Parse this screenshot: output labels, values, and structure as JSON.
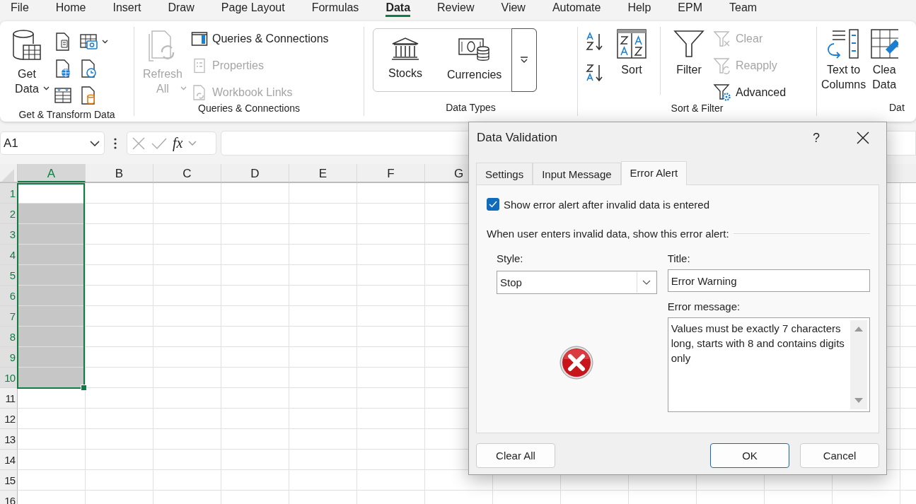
{
  "menu_tabs": [
    {
      "label": "File",
      "selected": false
    },
    {
      "label": "Home",
      "selected": false
    },
    {
      "label": "Insert",
      "selected": false
    },
    {
      "label": "Draw",
      "selected": false
    },
    {
      "label": "Page Layout",
      "selected": false
    },
    {
      "label": "Formulas",
      "selected": false
    },
    {
      "label": "Data",
      "selected": true
    },
    {
      "label": "Review",
      "selected": false
    },
    {
      "label": "View",
      "selected": false
    },
    {
      "label": "Automate",
      "selected": false
    },
    {
      "label": "Help",
      "selected": false
    },
    {
      "label": "EPM",
      "selected": false
    },
    {
      "label": "Team",
      "selected": false
    }
  ],
  "ribbon": {
    "get_transform": {
      "get_data": [
        "Get",
        "Data"
      ],
      "label": "Get & Transform Data"
    },
    "queries": {
      "refresh_all": {
        "lines": [
          "Refresh",
          "All"
        ],
        "disabled": true
      },
      "items": [
        {
          "kind": "queries",
          "label": "Queries & Connections",
          "disabled": false
        },
        {
          "kind": "properties",
          "label": "Properties",
          "disabled": true
        },
        {
          "kind": "links",
          "label": "Workbook Links",
          "disabled": true
        }
      ],
      "label": "Queries & Connections"
    },
    "data_types": {
      "items": [
        {
          "kind": "stocks",
          "label": "Stocks"
        },
        {
          "kind": "currencies",
          "label": "Currencies"
        }
      ],
      "label": "Data Types"
    },
    "sort_filter": {
      "sort": "Sort",
      "filter": "Filter",
      "items": [
        {
          "kind": "clear",
          "label": "Clear",
          "disabled": true
        },
        {
          "kind": "reapply",
          "label": "Reapply",
          "disabled": true
        },
        {
          "kind": "advanced",
          "label": "Advanced",
          "disabled": false
        }
      ],
      "label": "Sort & Filter"
    },
    "data_tools": {
      "buttons": [
        {
          "kind": "text_to_columns",
          "lines": [
            "Text to",
            "Columns"
          ]
        },
        {
          "kind": "clear_data",
          "lines": [
            "Clea",
            "Data"
          ]
        }
      ],
      "label": "Dat"
    }
  },
  "formula_bar": {
    "name_box": "A1",
    "function_label": "fx"
  },
  "grid": {
    "columns": [
      {
        "label": "A",
        "selected": true
      },
      {
        "label": "B",
        "selected": false
      },
      {
        "label": "C",
        "selected": false
      },
      {
        "label": "D",
        "selected": false
      },
      {
        "label": "E",
        "selected": false
      },
      {
        "label": "F",
        "selected": false
      },
      {
        "label": "G",
        "selected": false
      }
    ],
    "rows": [
      {
        "label": "1",
        "selected": true
      },
      {
        "label": "2",
        "selected": true
      },
      {
        "label": "3",
        "selected": true
      },
      {
        "label": "4",
        "selected": true
      },
      {
        "label": "5",
        "selected": true
      },
      {
        "label": "6",
        "selected": true
      },
      {
        "label": "7",
        "selected": true
      },
      {
        "label": "8",
        "selected": true
      },
      {
        "label": "9",
        "selected": true
      },
      {
        "label": "10",
        "selected": true
      },
      {
        "label": "11",
        "selected": false
      },
      {
        "label": "12",
        "selected": false
      },
      {
        "label": "13",
        "selected": false
      },
      {
        "label": "14",
        "selected": false
      },
      {
        "label": "15",
        "selected": false
      },
      {
        "label": "16",
        "selected": false
      }
    ]
  },
  "dialog": {
    "title": "Data Validation",
    "help": "?",
    "tabs": [
      {
        "label": "Settings",
        "selected": false
      },
      {
        "label": "Input Message",
        "selected": false
      },
      {
        "label": "Error Alert",
        "selected": true
      }
    ],
    "show_alert": {
      "label": "Show error alert after invalid data is entered",
      "checked": true
    },
    "section": "When user enters invalid data, show this error alert:",
    "style": {
      "label": "Style:",
      "value": "Stop"
    },
    "title_field": {
      "label": "Title:",
      "value": "Error Warning"
    },
    "message": {
      "label": "Error message:",
      "value": "Values must be exactly 7 characters long, starts with 8 and contains digits only"
    },
    "buttons": [
      {
        "label": "Clear All",
        "kind": "secondary"
      },
      {
        "label": "OK",
        "kind": "default"
      },
      {
        "label": "Cancel",
        "kind": "secondary"
      }
    ]
  }
}
